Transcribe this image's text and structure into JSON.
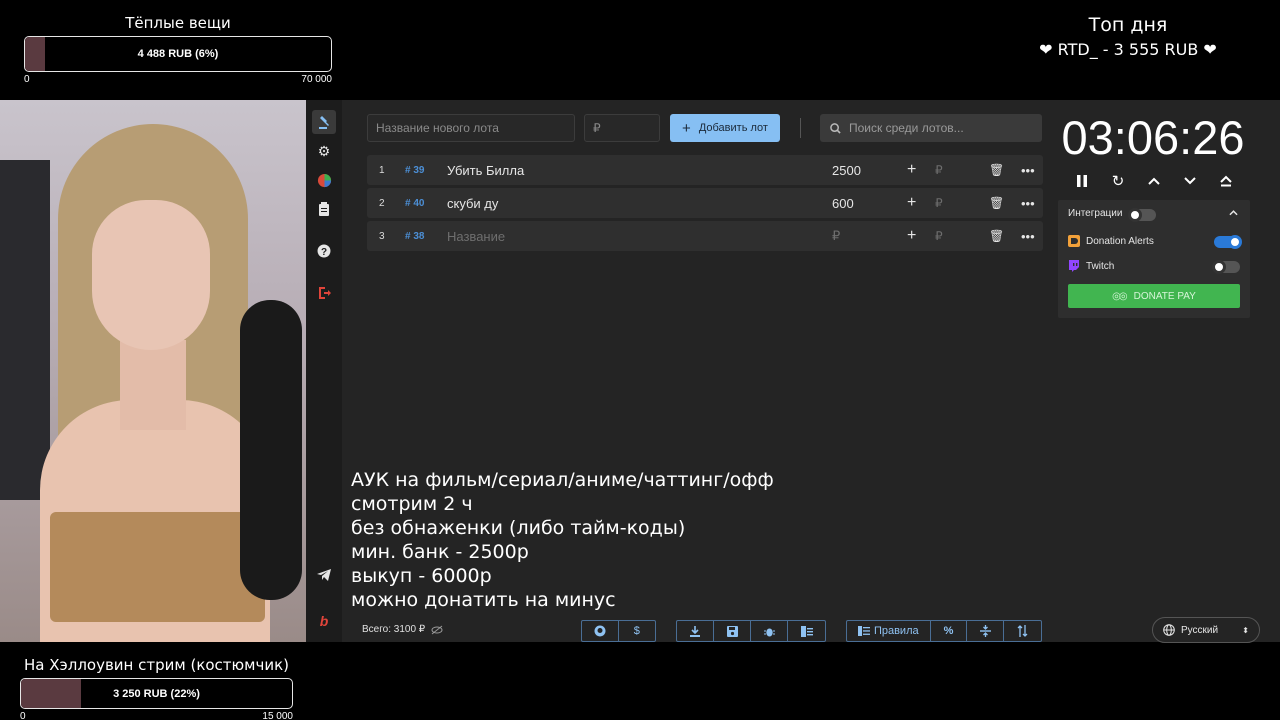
{
  "goal_top": {
    "title": "Тёплые вещи",
    "text": "4 488 RUB (6%)",
    "min": "0",
    "max": "70 000",
    "progress": 0.064
  },
  "goal_bottom": {
    "title": "На Хэллоувин стрим (костюмчик)",
    "text": "3 250 RUB (22%)",
    "min": "0",
    "max": "15 000",
    "progress": 0.22
  },
  "top_day": {
    "title": "Топ дня",
    "entry": "❤ RTD_ - 3 555 RUB ❤"
  },
  "toolbar": {
    "lot_name_placeholder": "Название нового лота",
    "amount_placeholder": "₽",
    "add_label": "Добавить лот",
    "search_placeholder": "Поиск среди лотов..."
  },
  "lots": [
    {
      "num": "1",
      "id": "# 39",
      "name": "Убить Билла",
      "amount": "2500"
    },
    {
      "num": "2",
      "id": "# 40",
      "name": "скуби ду",
      "amount": "600"
    },
    {
      "num": "3",
      "id": "# 38",
      "name": "Название",
      "amount": "₽"
    }
  ],
  "timer": {
    "value": "03:06:26"
  },
  "integrations": {
    "label": "Интеграции",
    "donation_alerts": "Donation Alerts",
    "donation_alerts_on": true,
    "twitch": "Twitch",
    "twitch_on": false,
    "donate_pay": "DONATE PAY"
  },
  "notes": [
    "АУК на фильм/сериал/аниме/чаттинг/офф",
    "смотрим 2 ч",
    "без обнаженки (либо тайм-коды)",
    "мин. банк - 2500р",
    "выкуп - 6000р",
    "можно донатить на минус"
  ],
  "footer": {
    "total": "Всего: 3100 ₽",
    "rules_label": "Правила",
    "language": "Русский"
  },
  "colors": {
    "accent": "#86bff3",
    "donate": "#41b550",
    "goal_fill": "#5a3a40",
    "id_blue": "#4c8fd6"
  },
  "icons": {
    "sidebar": [
      "gavel-icon",
      "gear-icon",
      "pie-chart-icon",
      "clipboard-icon",
      "help-icon",
      "logout-icon",
      "telegram-icon",
      "boosty-icon"
    ],
    "timer": [
      "pause-icon",
      "restart-icon",
      "chevron-up-icon",
      "chevron-down-icon",
      "eject-icon"
    ],
    "footer": [
      "github-icon",
      "dollar-icon",
      "download-icon",
      "save-icon",
      "bug-icon",
      "archive-icon",
      "rules-icon",
      "percent-icon",
      "split-icon",
      "sort-icon"
    ]
  }
}
